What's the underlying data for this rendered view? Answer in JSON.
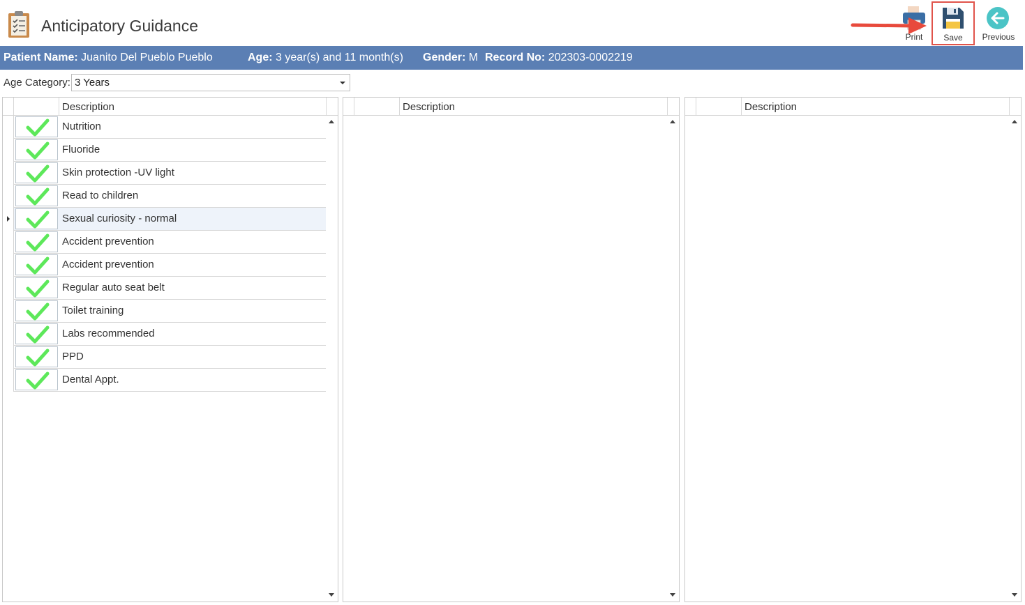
{
  "window": {
    "title": "Anticipatory Guidance"
  },
  "toolbar": {
    "print_label": "Print",
    "save_label": "Save",
    "previous_label": "Previous"
  },
  "patient": {
    "name_label": "Patient Name:",
    "name_value": "Juanito Del Pueblo Pueblo",
    "age_label": "Age:",
    "age_value": "3 year(s) and 11 month(s)",
    "gender_label": "Gender:",
    "gender_value": "M",
    "record_label": "Record No:",
    "record_value": "202303-0002219"
  },
  "age_category": {
    "label": "Age Category:",
    "selected": "3 Years"
  },
  "grids": [
    {
      "header": "Description",
      "current_row": 4,
      "rows": [
        {
          "checked": true,
          "description": "Nutrition"
        },
        {
          "checked": true,
          "description": "Fluoride"
        },
        {
          "checked": true,
          "description": "Skin protection -UV light"
        },
        {
          "checked": true,
          "description": "Read to children"
        },
        {
          "checked": true,
          "description": "Sexual curiosity - normal"
        },
        {
          "checked": true,
          "description": "Accident prevention"
        },
        {
          "checked": true,
          "description": "Accident prevention"
        },
        {
          "checked": true,
          "description": "Regular auto seat belt"
        },
        {
          "checked": true,
          "description": "Toilet training"
        },
        {
          "checked": true,
          "description": "Labs recommended"
        },
        {
          "checked": true,
          "description": "PPD"
        },
        {
          "checked": true,
          "description": "Dental Appt."
        }
      ]
    },
    {
      "header": "Description",
      "rows": []
    },
    {
      "header": "Description",
      "rows": []
    }
  ],
  "colors": {
    "patient_bar": "#5b7fb4",
    "check": "#5de85a",
    "highlight_box": "#e0534a",
    "previous_icon": "#4bc4c6"
  }
}
